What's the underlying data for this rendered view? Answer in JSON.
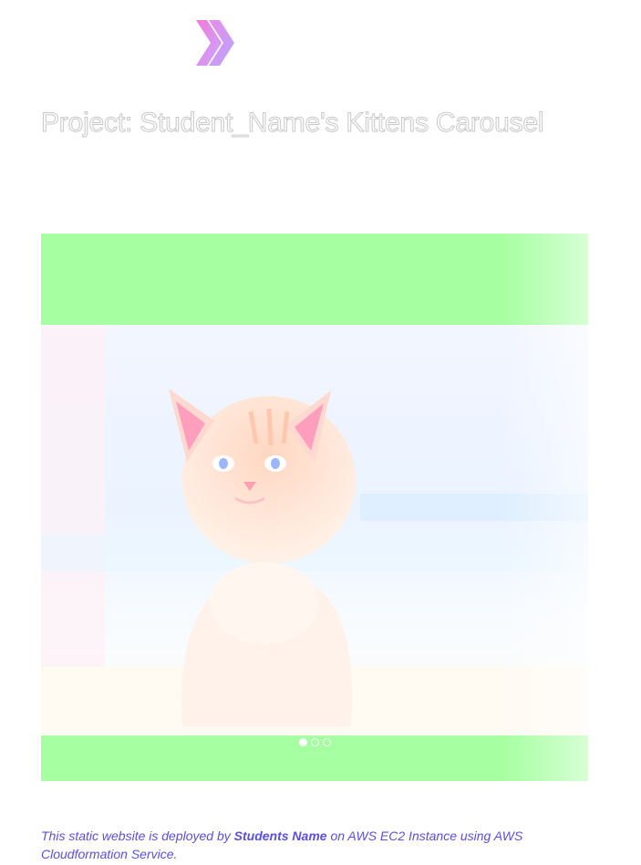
{
  "header": {
    "logo_icon": "double-chevron-right-icon",
    "title": "Project: Student_Name's Kittens Carousel"
  },
  "carousel": {
    "background_color": "#a6ffa1",
    "slide_image": "kitten-photo",
    "indicators": [
      {
        "active": true
      },
      {
        "active": false
      },
      {
        "active": false
      }
    ]
  },
  "footer": {
    "text_before": "This static website is deployed by ",
    "author": "Students Name",
    "text_after": " on AWS EC2 Instance using AWS Cloudformation Service."
  },
  "colors": {
    "logo_gradient_start": "#f07bd9",
    "logo_gradient_end": "#c9a6ff",
    "footer_text": "#5a4fe0"
  }
}
